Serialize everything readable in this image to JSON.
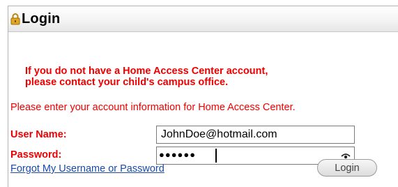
{
  "panel": {
    "title": "Login",
    "icon": "lock-icon"
  },
  "notice": {
    "line1": "If you do not have a Home Access Center account,",
    "line2": "please contact your child's campus office."
  },
  "instructions": "Please enter your account information for Home Access Center.",
  "form": {
    "username_label": "User Name:",
    "username_value": "JohnDoe@hotmail.com",
    "password_label": "Password:",
    "password_masked": "●●●●●●",
    "reveal_icon": "eye-icon"
  },
  "forgot_link": "Forgot My Username or Password",
  "login_button": "Login",
  "colors": {
    "label_red": "#ee0000",
    "link_blue": "#1a4aa8",
    "lock_gold": "#d9a21c"
  }
}
